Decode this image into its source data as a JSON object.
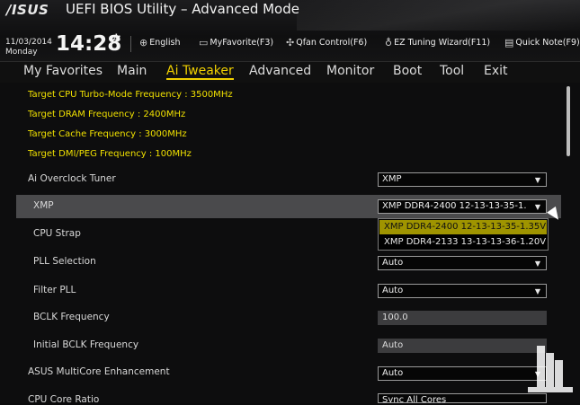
{
  "header": {
    "logo": "/ISUS",
    "title": "UEFI BIOS Utility – Advanced Mode",
    "date": "11/03/2014",
    "day": "Monday",
    "time": "14:28",
    "toolbar": [
      {
        "icon": "globe-icon",
        "label": "English"
      },
      {
        "icon": "favorite-icon",
        "label": "MyFavorite(F3)"
      },
      {
        "icon": "fan-icon",
        "label": "Qfan Control(F6)"
      },
      {
        "icon": "lightbulb-icon",
        "label": "EZ Tuning Wizard(F11)"
      },
      {
        "icon": "note-icon",
        "label": "Quick Note(F9)"
      }
    ]
  },
  "menu": {
    "tabs": [
      "My Favorites",
      "Main",
      "Ai Tweaker",
      "Advanced",
      "Monitor",
      "Boot",
      "Tool",
      "Exit"
    ],
    "active": "Ai Tweaker"
  },
  "info_lines": [
    "Target CPU Turbo-Mode Frequency : 3500MHz",
    "Target DRAM Frequency : 2400MHz",
    "Target Cache Frequency : 3000MHz",
    "Target DMI/PEG Frequency : 100MHz"
  ],
  "settings": [
    {
      "label": "Ai Overclock Tuner",
      "value": "XMP",
      "type": "dropdown"
    },
    {
      "label": "XMP",
      "value": "XMP DDR4-2400 12-13-13-35-1.",
      "type": "dropdown"
    },
    {
      "label": "CPU Strap",
      "value": "",
      "type": "hidden"
    },
    {
      "label": "PLL Selection",
      "value": "Auto",
      "type": "dropdown"
    },
    {
      "label": "Filter PLL",
      "value": "Auto",
      "type": "dropdown"
    },
    {
      "label": "BCLK Frequency",
      "value": "100.0",
      "type": "text"
    },
    {
      "label": "Initial BCLK Frequency",
      "value": "Auto",
      "type": "text"
    },
    {
      "label": "ASUS MultiCore Enhancement",
      "value": "Auto",
      "type": "dropdown"
    },
    {
      "label": "CPU Core Ratio",
      "value": "Sync All Cores",
      "type": "dropdown"
    }
  ],
  "xmp_dropdown": {
    "options": [
      "XMP DDR4-2400 12-13-13-35-1.35V",
      "XMP DDR4-2133 13-13-13-36-1.20V"
    ],
    "selected": "XMP DDR4-2400 12-13-13-35-1.35V"
  },
  "colors": {
    "accent": "#f0d000",
    "highlight_row": "#4a4a4c",
    "selected_option": "#9f9400"
  }
}
